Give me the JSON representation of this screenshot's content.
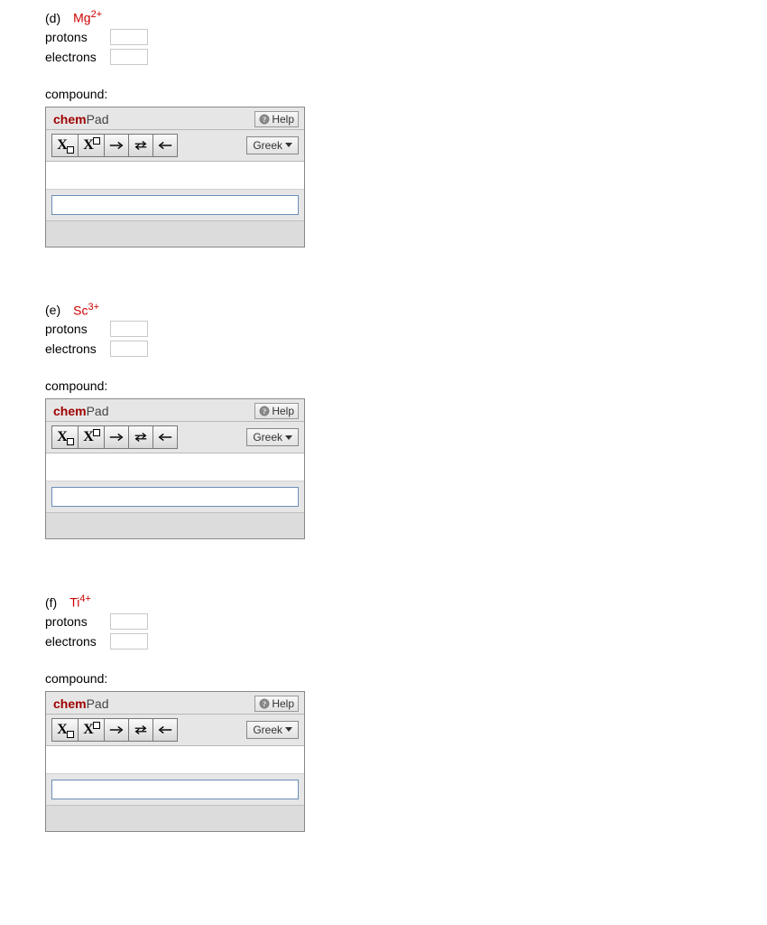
{
  "questions": [
    {
      "part": "(d)",
      "ion_element": "Mg",
      "ion_charge": "2+",
      "protons_label": "protons",
      "electrons_label": "electrons",
      "protons_value": "",
      "electrons_value": "",
      "compound_label": "compound:",
      "chempad_input": ""
    },
    {
      "part": "(e)",
      "ion_element": "Sc",
      "ion_charge": "3+",
      "protons_label": "protons",
      "electrons_label": "electrons",
      "protons_value": "",
      "electrons_value": "",
      "compound_label": "compound:",
      "chempad_input": ""
    },
    {
      "part": "(f)",
      "ion_element": "Ti",
      "ion_charge": "4+",
      "protons_label": "protons",
      "electrons_label": "electrons",
      "protons_value": "",
      "electrons_value": "",
      "compound_label": "compound:",
      "chempad_input": ""
    }
  ],
  "chempad": {
    "brand_chem": "chem",
    "brand_pad": "Pad",
    "help_label": "Help",
    "greek_label": "Greek",
    "buttons": {
      "subscript": "X",
      "superscript": "X",
      "forward_arrow": "→",
      "equilibrium_arrow": "⇌",
      "reverse_arrow": "←"
    }
  }
}
